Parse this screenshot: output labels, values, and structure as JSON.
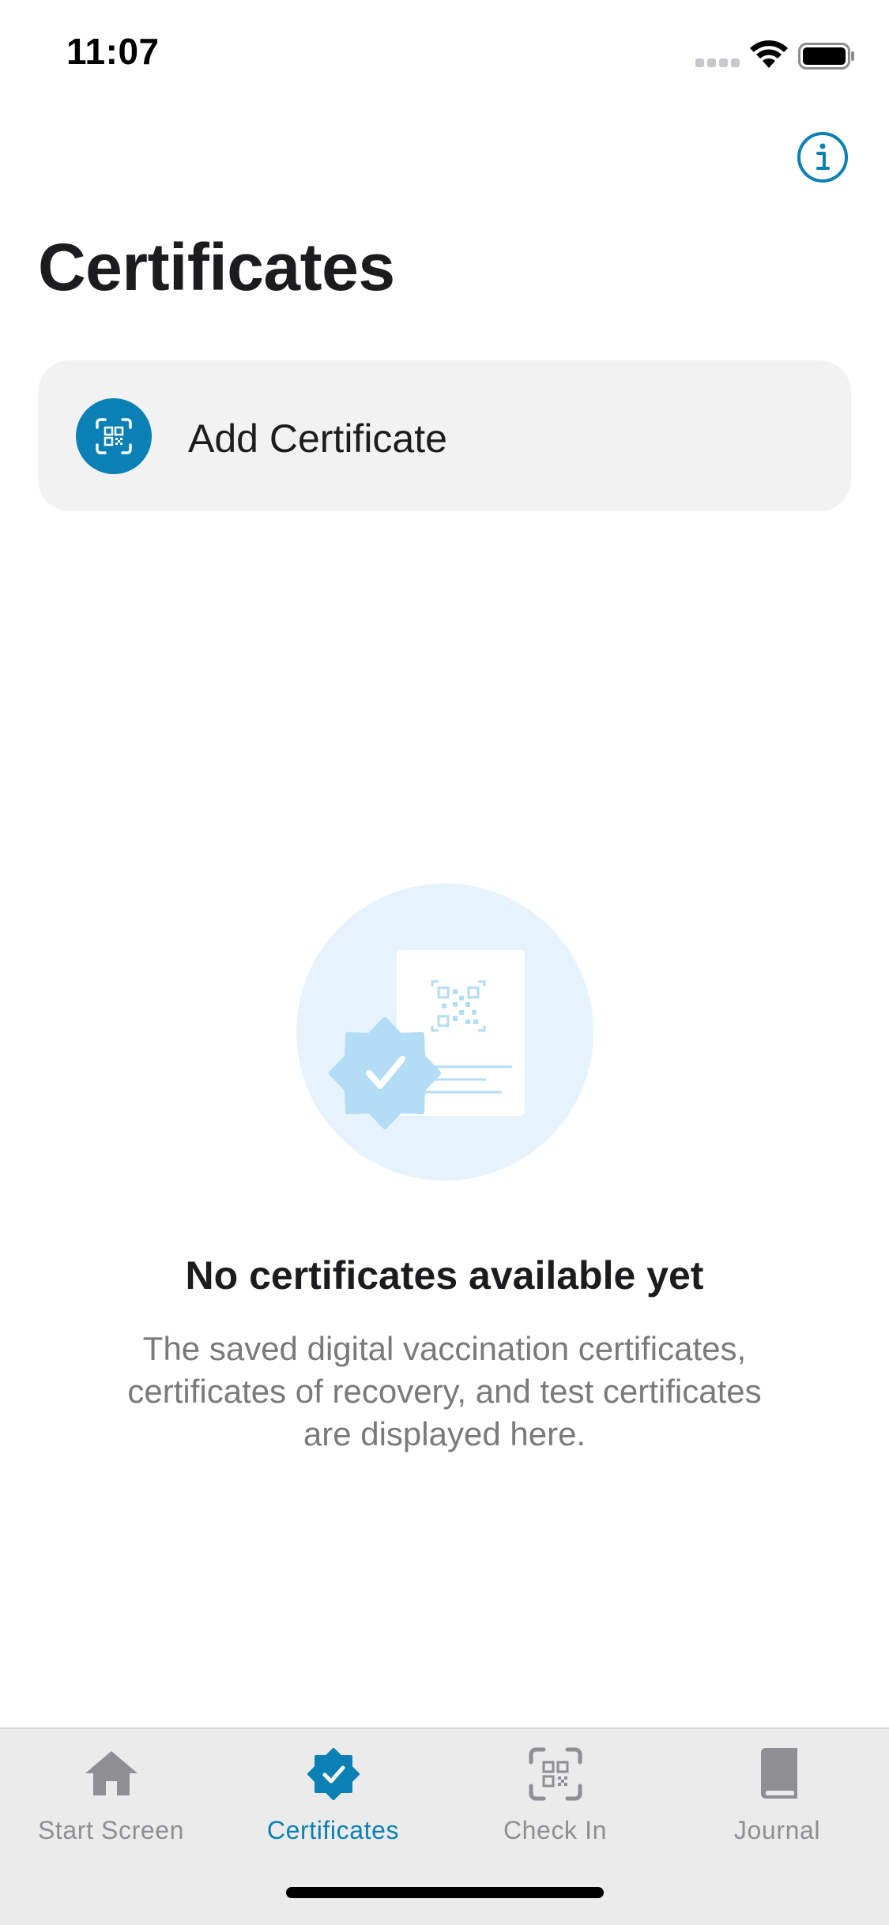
{
  "status_bar": {
    "time": "11:07"
  },
  "header": {
    "title": "Certificates",
    "info_icon": "info-circle-icon"
  },
  "add_certificate": {
    "label": "Add Certificate",
    "icon": "qr-scan-icon"
  },
  "empty_state": {
    "title": "No certificates available yet",
    "description": "The saved digital vaccination certificates, certificates of recovery, and test certificates are displayed here."
  },
  "tab_bar": {
    "tabs": [
      {
        "label": "Start Screen",
        "icon": "house-icon",
        "active": false
      },
      {
        "label": "Certificates",
        "icon": "certificate-badge-icon",
        "active": true
      },
      {
        "label": "Check In",
        "icon": "qr-scan-icon",
        "active": false
      },
      {
        "label": "Journal",
        "icon": "book-icon",
        "active": false
      }
    ]
  },
  "colors": {
    "accent": "#0a80b4",
    "inactive": "#8e8e93",
    "card_bg": "#f2f2f2",
    "illustration_bg": "#e6f3fd",
    "illustration_accent": "#b3dcf5"
  }
}
